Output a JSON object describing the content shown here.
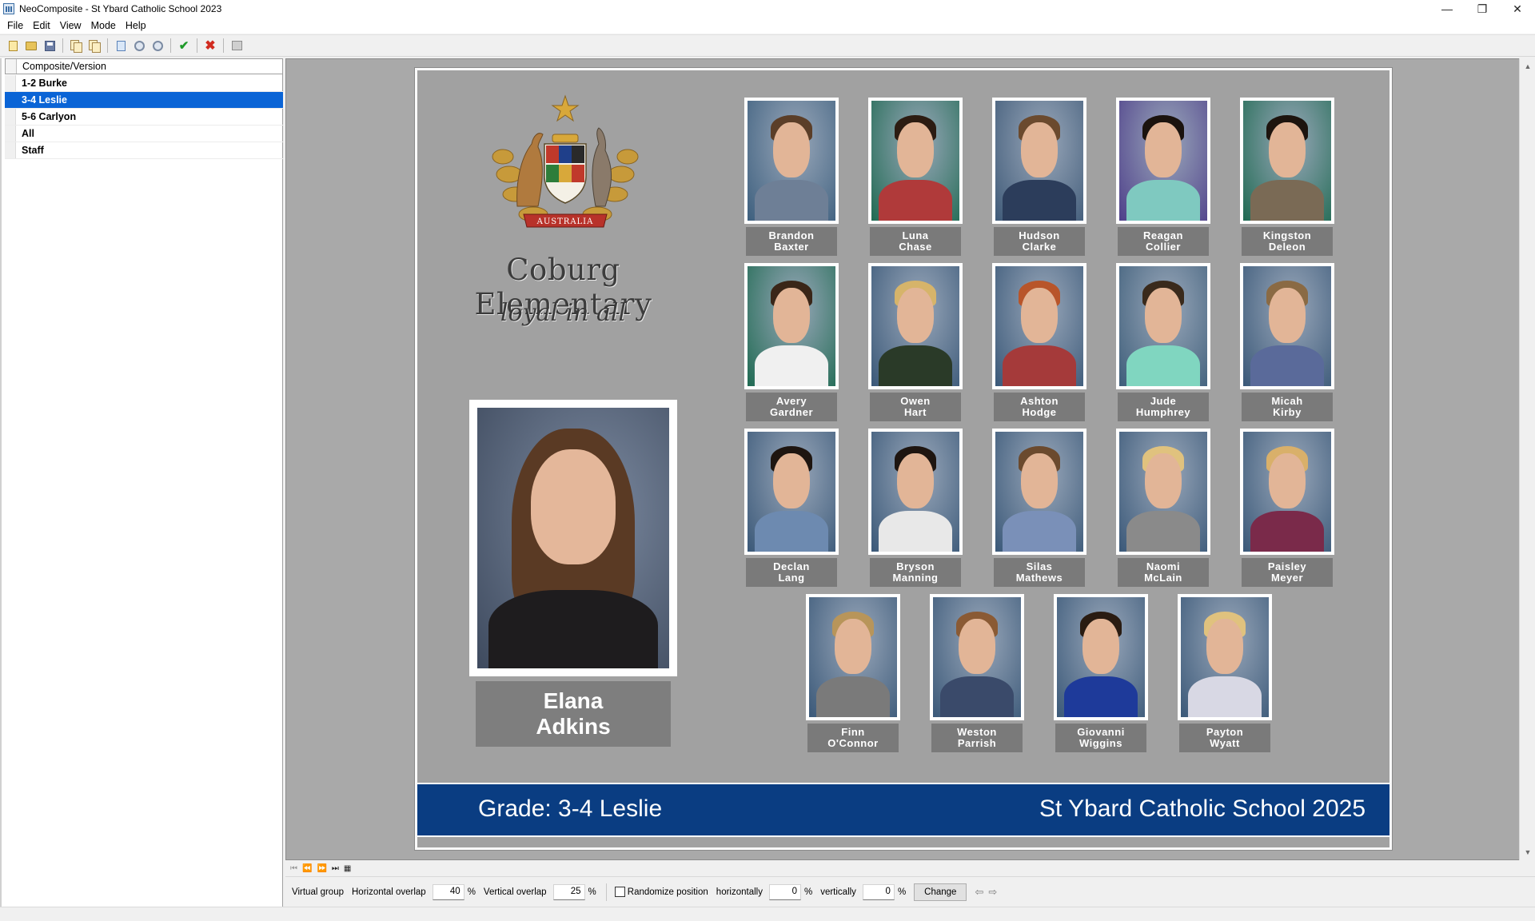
{
  "window": {
    "title": "NeoComposite - St Ybard Catholic School 2023",
    "controls": {
      "minimize": "—",
      "restore": "❐",
      "close": "✕"
    }
  },
  "menu": [
    "File",
    "Edit",
    "View",
    "Mode",
    "Help"
  ],
  "toolbar": {
    "icons": [
      "new-icon",
      "open-icon",
      "save-icon",
      "copy-icon",
      "paste-icon",
      "import-icon",
      "refresh-icon",
      "link-icon",
      "approve-icon",
      "delete-icon",
      "export-icon"
    ]
  },
  "tree": {
    "header": "Composite/Version",
    "items": [
      {
        "label": "1-2 Burke",
        "selected": false
      },
      {
        "label": "3-4 Leslie",
        "selected": true
      },
      {
        "label": "5-6 Carlyon",
        "selected": false
      },
      {
        "label": "All",
        "selected": false
      },
      {
        "label": "Staff",
        "selected": false
      }
    ]
  },
  "composite": {
    "crest_text": "AUSTRALIA",
    "school_name": "Coburg Elementary",
    "motto": "loyal in all",
    "teacher": {
      "first": "Elana",
      "last": "Adkins"
    },
    "students": [
      {
        "first": "Brandon",
        "last": "Baxter",
        "bg": "#3d5f7e",
        "hair": "#5b3e28",
        "shirt": "#6e7f96"
      },
      {
        "first": "Luna",
        "last": "Chase",
        "bg": "#1f6a52",
        "hair": "#2c1c12",
        "shirt": "#b03a3a"
      },
      {
        "first": "Hudson",
        "last": "Clarke",
        "bg": "#3f5a78",
        "hair": "#6b4a2e",
        "shirt": "#2c3d5b"
      },
      {
        "first": "Reagan",
        "last": "Collier",
        "bg": "#4e3f8a",
        "hair": "#1b130e",
        "shirt": "#7fc9c0"
      },
      {
        "first": "Kingston",
        "last": "Deleon",
        "bg": "#1f6a52",
        "hair": "#1d140e",
        "shirt": "#7a6a55"
      },
      {
        "first": "Avery",
        "last": "Gardner",
        "bg": "#1f6a52",
        "hair": "#3a2618",
        "shirt": "#f0f0f0"
      },
      {
        "first": "Owen",
        "last": "Hart",
        "bg": "#3a5878",
        "hair": "#d6b46a",
        "shirt": "#2a3a28"
      },
      {
        "first": "Ashton",
        "last": "Hodge",
        "bg": "#3a5878",
        "hair": "#b8552a",
        "shirt": "#a53a3a"
      },
      {
        "first": "Jude",
        "last": "Humphrey",
        "bg": "#3e5e7a",
        "hair": "#3a2a1c",
        "shirt": "#80d6c0"
      },
      {
        "first": "Micah",
        "last": "Kirby",
        "bg": "#3a5878",
        "hair": "#8a6a44",
        "shirt": "#5a6a9a"
      },
      {
        "first": "Declan",
        "last": "Lang",
        "bg": "#3a5878",
        "hair": "#1e1510",
        "shirt": "#6d8ab0"
      },
      {
        "first": "Bryson",
        "last": "Manning",
        "bg": "#3a5878",
        "hair": "#1e1510",
        "shirt": "#e8e8e8"
      },
      {
        "first": "Silas",
        "last": "Mathews",
        "bg": "#3a5878",
        "hair": "#6b4a2e",
        "shirt": "#7a90b8"
      },
      {
        "first": "Naomi",
        "last": "McLain",
        "bg": "#3a5878",
        "hair": "#e0c27e",
        "shirt": "#8a8a8a"
      },
      {
        "first": "Paisley",
        "last": "Meyer",
        "bg": "#3a5878",
        "hair": "#d9b06a",
        "shirt": "#7a2a4a"
      },
      {
        "first": "Finn",
        "last": "O'Connor",
        "bg": "#3a5878",
        "hair": "#b8955a",
        "shirt": "#7a7a7a"
      },
      {
        "first": "Weston",
        "last": "Parrish",
        "bg": "#3a5878",
        "hair": "#8a5a34",
        "shirt": "#3a4a6a"
      },
      {
        "first": "Giovanni",
        "last": "Wiggins",
        "bg": "#3a5878",
        "hair": "#2a1c12",
        "shirt": "#1e3a9a"
      },
      {
        "first": "Payton",
        "last": "Wyatt",
        "bg": "#3a5878",
        "hair": "#e0c27e",
        "shirt": "#d8d8e4"
      }
    ],
    "footer": {
      "grade": "Grade: 3-4 Leslie",
      "school": "St Ybard Catholic School 2025"
    }
  },
  "nav": [
    "⏮",
    "⏪",
    "⏩",
    "⏭",
    "▦"
  ],
  "options": {
    "virtual_group": "Virtual group",
    "h_overlap_label": "Horizontal overlap",
    "h_overlap_value": "40",
    "v_overlap_label": "Vertical overlap",
    "v_overlap_value": "25",
    "pct": "%",
    "randomize_label": "Randomize position",
    "horizontally_label": "horizontally",
    "horizontally_value": "0",
    "vertically_label": "vertically",
    "vertically_value": "0",
    "change_button": "Change",
    "prev_arrow": "⇦",
    "next_arrow": "⇨"
  }
}
